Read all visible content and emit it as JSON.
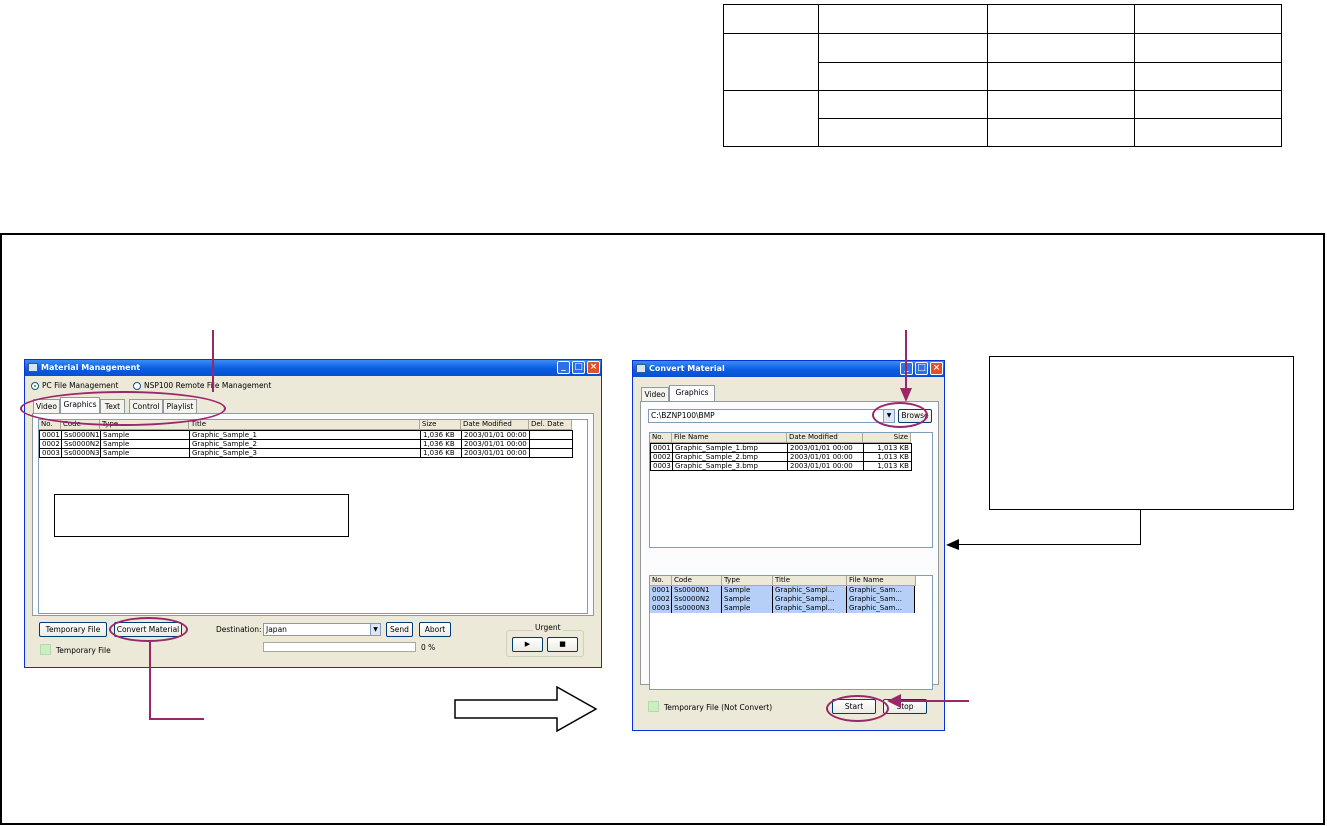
{
  "material_window": {
    "title": "Material Management",
    "radio_pc": "PC File Management",
    "radio_remote": "NSP100 Remote File Management",
    "tabs": [
      "Video",
      "Graphics",
      "Text",
      "Control",
      "Playlist"
    ],
    "columns": [
      "No.",
      "Code",
      "Type",
      "Title",
      "Size",
      "Date Modified",
      "Del. Date"
    ],
    "rows": [
      [
        "0001",
        "Ss0000N1",
        "Sample",
        "Graphic_Sample_1",
        "1,036 KB",
        "2003/01/01 00:00",
        ""
      ],
      [
        "0002",
        "Ss0000N2",
        "Sample",
        "Graphic_Sample_2",
        "1,036 KB",
        "2003/01/01 00:00",
        ""
      ],
      [
        "0003",
        "Ss0000N3",
        "Sample",
        "Graphic_Sample_3",
        "1,036 KB",
        "2003/01/01 00:00",
        ""
      ]
    ],
    "temporary_file_button": "Temporary File",
    "convert_material_button": "Convert Material",
    "destination_label": "Destination:",
    "destination_value": "Japan",
    "send_button": "Send",
    "abort_button": "Abort",
    "urgent_label": "Urgent",
    "play_icon": "▶",
    "stop_icon": "■",
    "progress_text": "0 %",
    "progress_value": 0,
    "temporary_file_indicator": "Temporary File"
  },
  "convert_window": {
    "title": "Convert Material",
    "tabs": [
      "Video",
      "Graphics"
    ],
    "path_value": "C:\\BZNP100\\BMP",
    "browse_button": "Browse",
    "file_columns": [
      "No.",
      "File Name",
      "Date Modified",
      "Size"
    ],
    "file_rows": [
      [
        "0001",
        "Graphic_Sample_1.bmp",
        "2003/01/01 00:00",
        "1,013 KB"
      ],
      [
        "0002",
        "Graphic_Sample_2.bmp",
        "2003/01/01 00:00",
        "1,013 KB"
      ],
      [
        "0003",
        "Graphic_Sample_3.bmp",
        "2003/01/01 00:00",
        "1,013 KB"
      ]
    ],
    "material_columns": [
      "No.",
      "Code",
      "Type",
      "Title",
      "File Name"
    ],
    "material_rows": [
      [
        "0001",
        "Ss0000N1",
        "Sample",
        "Graphic_Sampl...",
        "Graphic_Sam..."
      ],
      [
        "0002",
        "Ss0000N2",
        "Sample",
        "Graphic_Sampl...",
        "Graphic_Sam..."
      ],
      [
        "0003",
        "Ss0000N3",
        "Sample",
        "Graphic_Sampl...",
        "Graphic_Sam..."
      ]
    ],
    "temporary_file_indicator": "Temporary File (Not Convert)",
    "start_button": "Start",
    "stop_button": "Stop"
  },
  "colors": {
    "annotation": "#99286b",
    "title_bar": "#0a5ce0",
    "window_bg": "#ece9d8",
    "selection": "#b5cff7"
  }
}
